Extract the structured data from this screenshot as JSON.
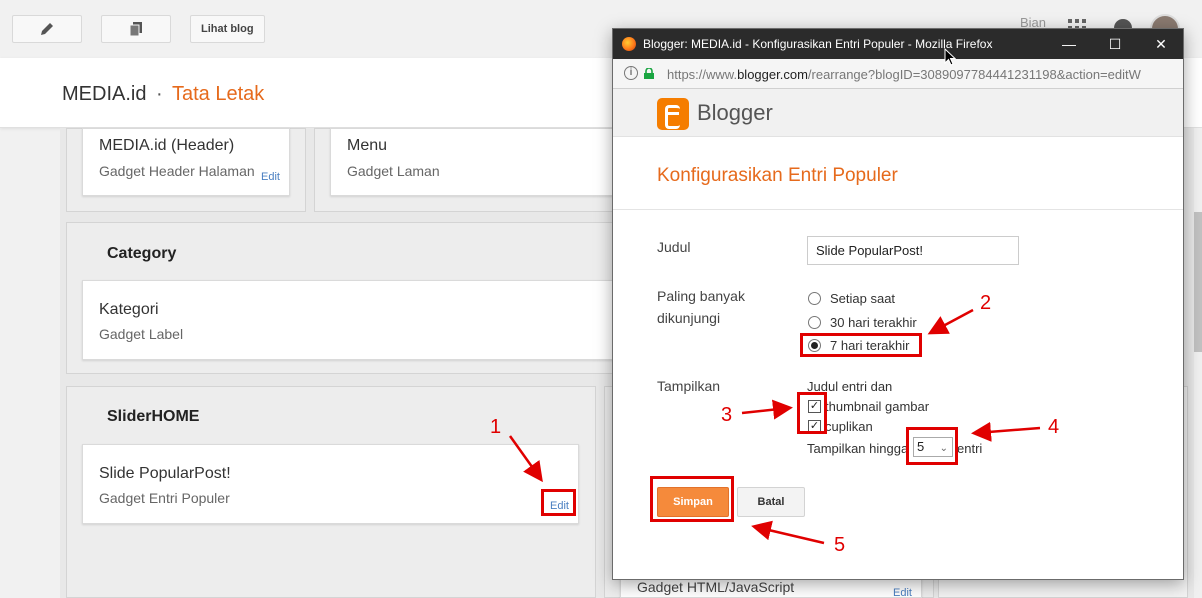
{
  "topbar": {
    "view_blog_label": "Lihat blog",
    "right_text": "Bian"
  },
  "header": {
    "site_title": "MEDIA.id",
    "separator": "·",
    "page_name": "Tata Letak"
  },
  "layout": {
    "sections": [
      {
        "title": ""
      },
      {
        "title": "Category"
      },
      {
        "title": "SliderHOME"
      }
    ],
    "gadgets": [
      {
        "title": "MEDIA.id (Header)",
        "subtitle": "Gadget Header Halaman",
        "edit": "Edit"
      },
      {
        "title": "Menu",
        "subtitle": "Gadget Laman",
        "edit": ""
      },
      {
        "title": "Kategori",
        "subtitle": "Gadget Label",
        "edit": ""
      },
      {
        "title": "Slide PopularPost!",
        "subtitle": "Gadget Entri Populer",
        "edit": "Edit"
      },
      {
        "title": "",
        "subtitle": "Gadget HTML/JavaScript",
        "edit": "Edit"
      }
    ]
  },
  "firefox": {
    "window_title": "Blogger: MEDIA.id - Konfigurasikan Entri Populer - Mozilla Firefox",
    "url_prefix": "https://www.",
    "url_domain": "blogger.com",
    "url_suffix": "/rearrange?blogID=3089097784441231198&action=editW"
  },
  "dialog": {
    "brand": "Blogger",
    "title": "Konfigurasikan Entri Populer",
    "judul_label": "Judul",
    "judul_value": "Slide PopularPost!",
    "most_viewed_label_line1": "Paling banyak",
    "most_viewed_label_line2": "dikunjungi",
    "range_options": [
      "Setiap saat",
      "30 hari terakhir",
      "7 hari terakhir"
    ],
    "range_selected": "7 hari terakhir",
    "show_label": "Tampilkan",
    "show_intro": "Judul entri dan",
    "show_options": [
      {
        "label": "thumbnail gambar",
        "checked": true
      },
      {
        "label": "cuplikan",
        "checked": true
      }
    ],
    "count_prefix": "Tampilkan hingga",
    "count_value": "5",
    "count_suffix": "entri",
    "save_label": "Simpan",
    "cancel_label": "Batal"
  },
  "annotations": [
    "1",
    "2",
    "3",
    "4",
    "5"
  ],
  "colors": {
    "accent": "#e66a1c",
    "save_button": "#f58a3b",
    "annotation": "#e00000"
  }
}
